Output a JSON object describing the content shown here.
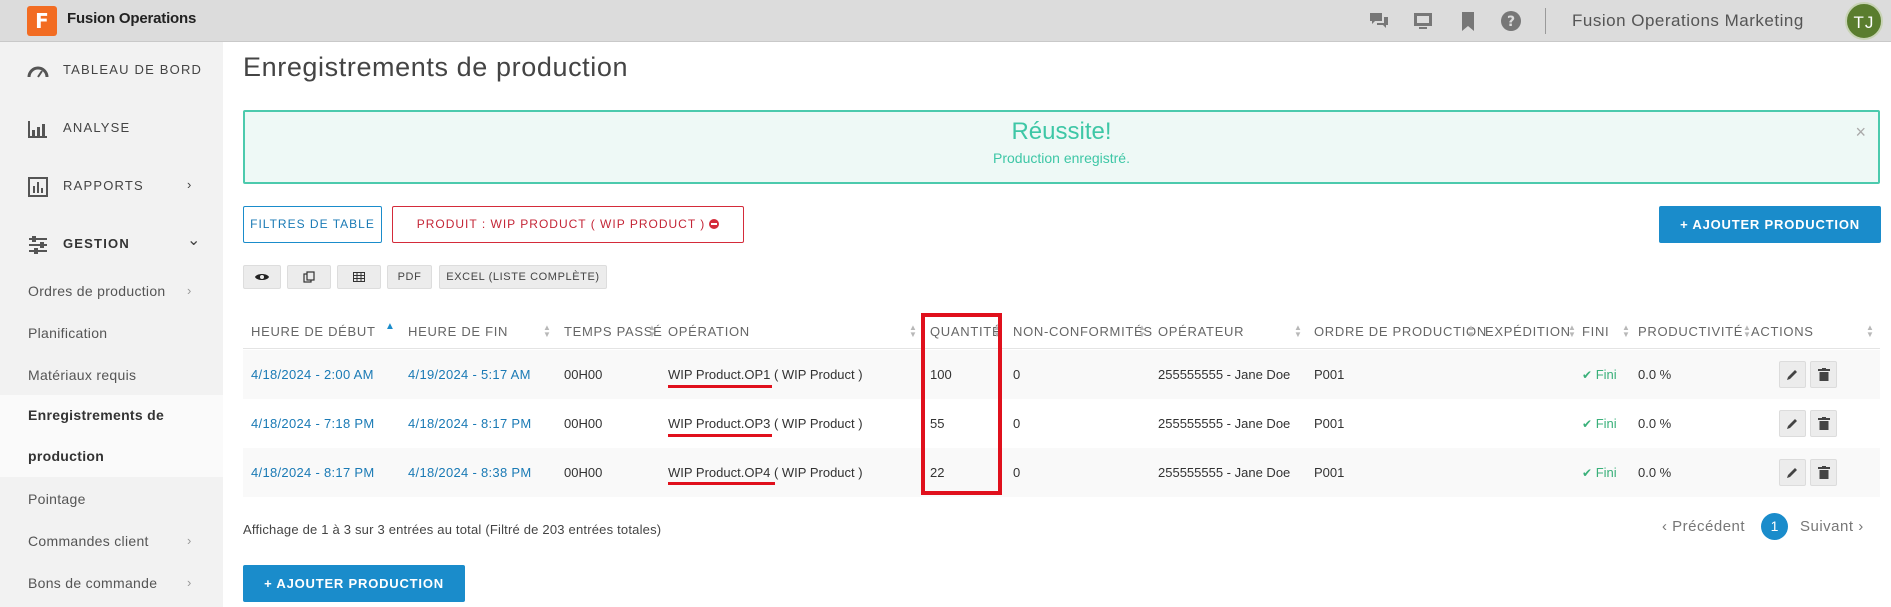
{
  "app": {
    "logo_letter": "F",
    "name": "Fusion Operations",
    "org": "Fusion Operations Marketing",
    "avatar_initials": "TJ"
  },
  "header_icons": [
    "chat-icon",
    "screen-icon",
    "bookmark-icon",
    "help-icon"
  ],
  "sidebar": {
    "main": [
      {
        "label": "TABLEAU DE BORD",
        "icon": "gauge-icon"
      },
      {
        "label": "ANALYSE",
        "icon": "analytics-icon"
      },
      {
        "label": "RAPPORTS",
        "icon": "report-icon",
        "chevron": "›"
      },
      {
        "label": "GESTION",
        "icon": "sliders-icon",
        "chevron": "⌄"
      }
    ],
    "sub": [
      {
        "label": "Ordres de production",
        "chevron": "›"
      },
      {
        "label": "Planification"
      },
      {
        "label": "Matériaux requis"
      },
      {
        "label_line1": "Enregistrements de",
        "label_line2": "production"
      },
      {
        "label": "Pointage"
      },
      {
        "label": "Commandes client",
        "chevron": "›"
      },
      {
        "label": "Bons de commande",
        "chevron": "›"
      }
    ]
  },
  "page": {
    "title": "Enregistrements de production"
  },
  "alert": {
    "title": "Réussite!",
    "message": "Production enregistré.",
    "close": "×"
  },
  "filters": {
    "table_filters": "FILTRES DE TABLE",
    "chip": "PRODUIT : WIP PRODUCT ( WIP PRODUCT )"
  },
  "add_production": "+ AJOUTER PRODUCTION",
  "toolbar": {
    "pdf": "PDF",
    "excel": "EXCEL (LISTE COMPLÈTE)"
  },
  "table": {
    "headers": [
      "HEURE DE DÉBUT",
      "HEURE DE FIN",
      "TEMPS PASSÉ",
      "OPÉRATION",
      "QUANTITÉ",
      "NON-CONFORMITÉS",
      "OPÉRATEUR",
      "ORDRE DE PRODUCTION",
      "EXPÉDITION",
      "FINI",
      "PRODUCTIVITÉ",
      "ACTIONS"
    ],
    "rows": [
      {
        "start": "4/18/2024 - 2:00 AM",
        "end": "4/19/2024 - 5:17 AM",
        "time": "00H00",
        "op_name": "WIP Product.OP1",
        "op_product": " ( WIP Product )",
        "qty": "100",
        "nc": "0",
        "operator": "255555555 - Jane Doe",
        "order": "P001",
        "shipping": "",
        "fini": "Fini",
        "productivity": "0.0 %"
      },
      {
        "start": "4/18/2024 - 7:18 PM",
        "end": "4/18/2024 - 8:17 PM",
        "time": "00H00",
        "op_name": "WIP Product.OP3",
        "op_product": " ( WIP Product )",
        "qty": "55",
        "nc": "0",
        "operator": "255555555 - Jane Doe",
        "order": "P001",
        "shipping": "",
        "fini": "Fini",
        "productivity": "0.0 %"
      },
      {
        "start": "4/18/2024 - 8:17 PM",
        "end": "4/18/2024 - 8:38 PM",
        "time": "00H00",
        "op_name": "WIP Product.OP4",
        "op_product": " ( WIP Product )",
        "qty": "22",
        "nc": "0",
        "operator": "255555555 - Jane Doe",
        "order": "P001",
        "shipping": "",
        "fini": "Fini",
        "productivity": "0.0 %"
      }
    ]
  },
  "footer": {
    "info": "Affichage de 1 à 3 sur 3 entrées au total (Filtré de 203 entrées totales)",
    "prev": "‹ Précédent",
    "page": "1",
    "next": "Suivant ›"
  },
  "colors": {
    "primary": "#1a8ccb",
    "success": "#3ec7a6",
    "danger": "#e0101c",
    "logo": "#f26c22",
    "avatar": "#5a7d2e"
  }
}
